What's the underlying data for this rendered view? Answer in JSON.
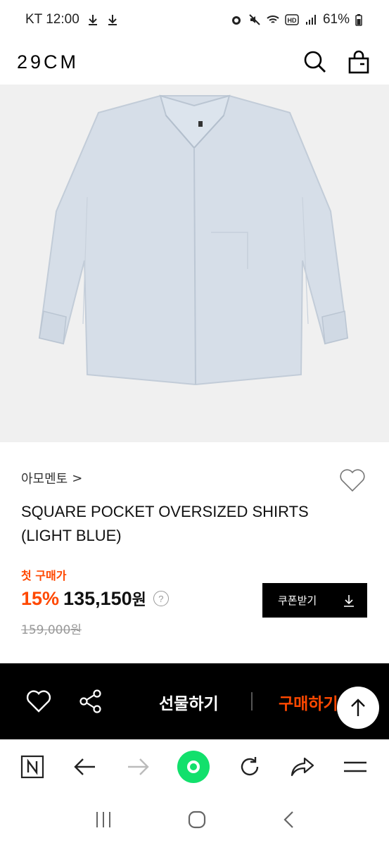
{
  "status_bar": {
    "carrier_time": "KT 12:00",
    "battery": "61%"
  },
  "header": {
    "logo": "29CM",
    "icons": [
      "search-icon",
      "shopping-bag-icon"
    ]
  },
  "product": {
    "brand": "아모멘토",
    "brand_chevron": ">",
    "title": "SQUARE POCKET OVERSIZED SHIRTS (LIGHT BLUE)",
    "first_purchase_label": "첫 구매가",
    "discount": "15%",
    "price": "135,150",
    "price_unit": "원",
    "help": "?",
    "original_price": "159,000원",
    "coupon_button": "쿠폰받기",
    "colors": {
      "accent": "#ff4800",
      "shirt": "#d6dee8"
    }
  },
  "action_bar": {
    "gift_label": "선물하기",
    "buy_label": "구매하기"
  },
  "browser_bar": {
    "icons": [
      "naver-icon",
      "back-arrow-icon",
      "forward-arrow-icon",
      "home-icon",
      "refresh-icon",
      "share-icon",
      "menu-icon"
    ]
  },
  "system_nav": {
    "icons": [
      "recents-icon",
      "home-circle-icon",
      "back-chevron-icon"
    ]
  }
}
